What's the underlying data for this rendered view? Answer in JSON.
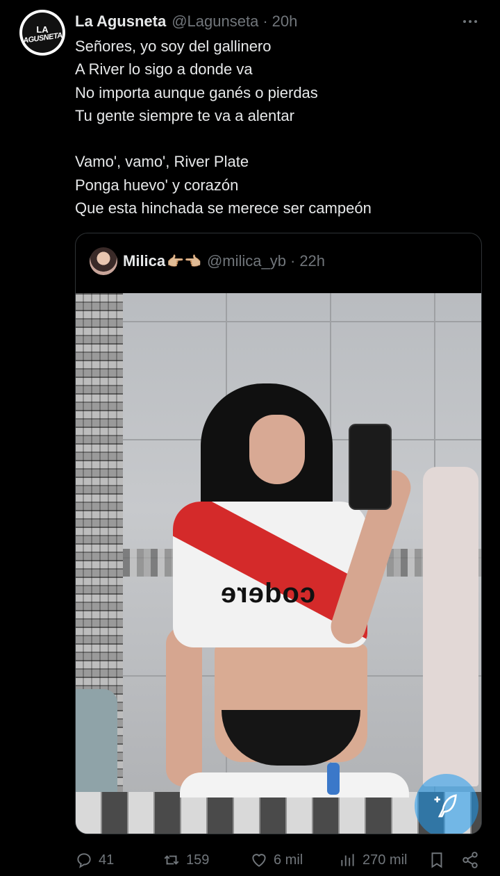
{
  "tweet": {
    "display_name": "La Agusneta",
    "handle": "@Lagunseta",
    "separator": "·",
    "time": "20h",
    "avatar_text_top": "LA",
    "avatar_text_bottom": "AGUSNETA",
    "text": "Señores, yo soy del gallinero\nA River lo sigo a donde va\nNo importa aunque ganés o pierdas\nTu gente siempre te va a alentar\n\nVamo', vamo', River Plate\nPonga huevo' y corazón\nQue esta hinchada se merece ser campeón"
  },
  "quote": {
    "display_name": "Milica",
    "emoji": "👉🏼👈🏼",
    "handle": "@milica_yb",
    "separator": "·",
    "time": "22h",
    "shirt_text": "codere"
  },
  "actions": {
    "replies": "41",
    "retweets": "159",
    "likes": "6 mil",
    "views": "270 mil"
  },
  "icons": {
    "more": "more-icon",
    "reply": "reply-icon",
    "retweet": "retweet-icon",
    "like": "heart-icon",
    "views": "views-icon",
    "bookmark": "bookmark-icon",
    "share": "share-icon",
    "compose": "compose-icon"
  },
  "colors": {
    "background": "#000000",
    "text": "#e7e9ea",
    "secondary": "#71767b",
    "accent": "#1d9bf0"
  }
}
